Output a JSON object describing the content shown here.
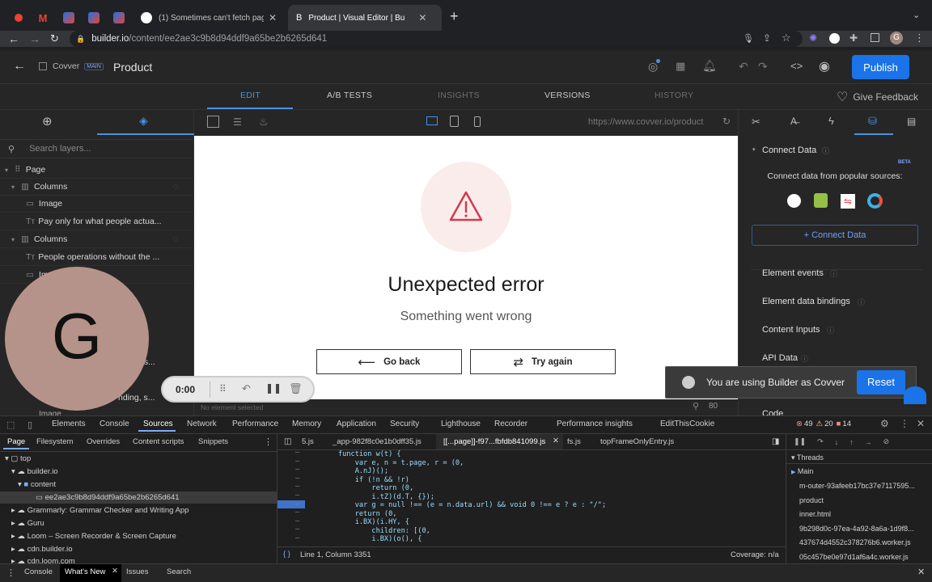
{
  "browser": {
    "tabs": [
      {
        "title": "(1) Sometimes can't fetch page",
        "active": false
      },
      {
        "title": "Product | Visual Editor | Bu",
        "active": true
      }
    ],
    "new_tab": "+",
    "url_host": "builder.io",
    "url_path": "/content/ee2ae3c9b8d94ddf9a65be2b6265d641",
    "profile_initial": "G"
  },
  "app": {
    "space": "Covver",
    "space_badge": "MAIN",
    "page_title": "Product",
    "publish": "Publish",
    "give_feedback": "Give Feedback",
    "tabs": [
      {
        "label": "EDIT",
        "state": "active"
      },
      {
        "label": "A/B TESTS",
        "state": "normal"
      },
      {
        "label": "INSIGHTS",
        "state": "disabled"
      },
      {
        "label": "VERSIONS",
        "state": "normal"
      },
      {
        "label": "HISTORY",
        "state": "disabled"
      }
    ]
  },
  "layers": {
    "search_placeholder": "Search layers...",
    "items": [
      {
        "label": "Page",
        "indent": 0
      },
      {
        "label": "Columns",
        "indent": 1
      },
      {
        "label": "Image",
        "indent": 2
      },
      {
        "label": "Pay only for what people actua...",
        "indent": 2
      },
      {
        "label": "Columns",
        "indent": 1
      },
      {
        "label": "People operations without the ...",
        "indent": 2
      },
      {
        "label": "Im",
        "indent": 2
      }
    ],
    "partial_a": "es...",
    "partial_b": "nding, s...",
    "partial_c": "Image"
  },
  "canvas": {
    "url": "https://www.covver.io/product",
    "zoom": "80",
    "no_element": "No element selected",
    "error_title": "Unexpected error",
    "error_subtitle": "Something went wrong",
    "go_back": "Go back",
    "try_again": "Try again"
  },
  "overlay": {
    "avatar_letter": "G",
    "timer": "0:00",
    "toast": "You are using Builder as Covver",
    "reset": "Reset"
  },
  "right": {
    "connect_data": "Connect Data",
    "beta": "BETA",
    "connect_sub": "Connect data from popular sources:",
    "connect_btn": "+ Connect Data",
    "sections": [
      "Element events",
      "Element data bindings",
      "Content Inputs",
      "API Data",
      "Code"
    ]
  },
  "devtools": {
    "tabs": [
      "Elements",
      "Console",
      "Sources",
      "Network",
      "Performance",
      "Memory",
      "Application",
      "Security",
      "Lighthouse",
      "Recorder",
      "Performance insights",
      "EditThisCookie"
    ],
    "active_tab": "Sources",
    "errors": "49",
    "warnings": "20",
    "issues": "14",
    "nav_tabs": [
      "Page",
      "Filesystem",
      "Overrides",
      "Content scripts",
      "Snippets"
    ],
    "tree": [
      "top",
      "builder.io",
      "content",
      "ee2ae3c9b8d94ddf9a65be2b6265d641",
      "Grammarly: Grammar Checker and Writing App",
      "Guru",
      "Loom – Screen Recorder & Screen Capture",
      "cdn.builder.io",
      "cdn.loom.com"
    ],
    "files": [
      "5.js",
      "_app-982f8c0e1b0dff35.js",
      "[[...page]]-f97...fbfdb841099.js",
      "fs.js",
      "topFrameOnlyEntry.js"
    ],
    "code": [
      "function w(t) {",
      "    var e, n = t.page, r = (0,",
      "    A.nJ)();",
      "    if (!n && !r)",
      "        return (0,",
      "        i.tZ)(d.T, {});",
      "    var g = null !== (e = n.data.url) && void 0 !== e ? e : \"/\";",
      "    return (0,",
      "    i.BX)(i.HY, {",
      "        children: [(0,",
      "        i.BX)(o(), {"
    ],
    "status": "Line 1, Column 3351",
    "coverage": "Coverage: n/a",
    "threads_title": "Threads",
    "threads": [
      "Main",
      "m-outer-93afeeb17bc37e7117595...",
      "product",
      "inner.html",
      "9b298d0c-97ea-4a92-8a6a-1d9f8...",
      "437674d4552c378276b6.worker.js",
      "05c457be0e97d1af6a4c.worker.js"
    ],
    "drawer": [
      "Console",
      "What's New",
      "Issues",
      "Search"
    ]
  }
}
